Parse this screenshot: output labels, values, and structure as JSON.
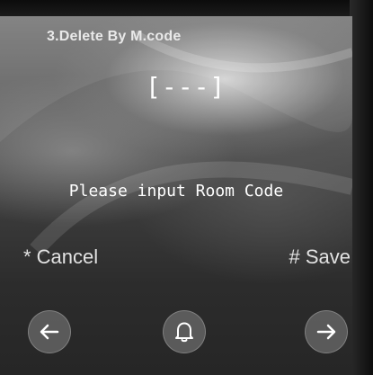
{
  "screen": {
    "title": "3.Delete By M.code",
    "code_display": "[---]",
    "prompt": "Please input Room Code"
  },
  "actions": {
    "cancel_label": "* Cancel",
    "save_label": "# Save"
  },
  "buttons": {
    "back_icon": "left-arrow-icon",
    "bell_icon": "bell-icon",
    "next_icon": "right-arrow-icon"
  }
}
